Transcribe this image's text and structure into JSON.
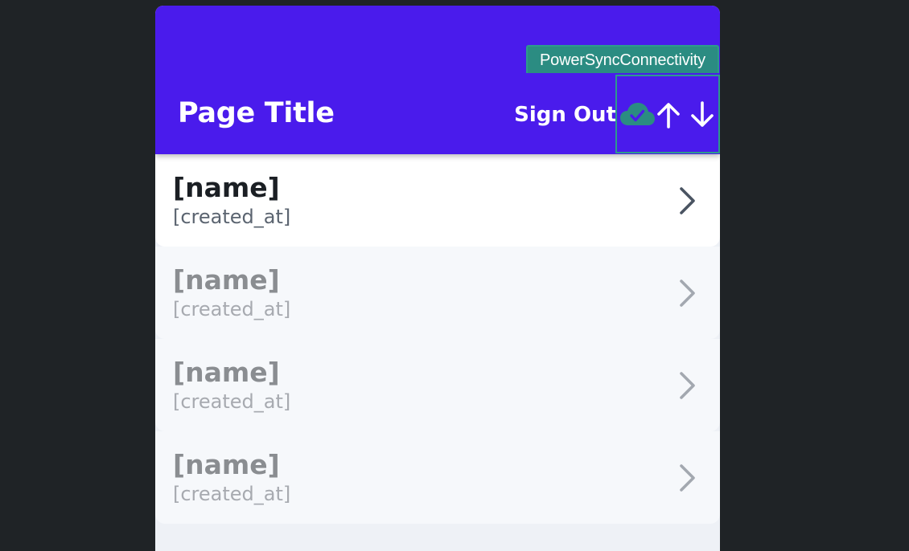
{
  "app_bar": {
    "title": "Page Title",
    "sign_out_label": "Sign Out",
    "background_color": "#4a1bec"
  },
  "connectivity": {
    "tag_label": "PowerSyncConnectivity",
    "tag_color": "#2b8c82",
    "status_icon": "cloud-check-icon",
    "upload_icon": "arrow-up-icon",
    "download_icon": "arrow-down-icon"
  },
  "list": {
    "items": [
      {
        "name": "[name]",
        "created_at": "[created_at]",
        "state": "active"
      },
      {
        "name": "[name]",
        "created_at": "[created_at]",
        "state": "faded"
      },
      {
        "name": "[name]",
        "created_at": "[created_at]",
        "state": "faded"
      },
      {
        "name": "[name]",
        "created_at": "[created_at]",
        "state": "faded"
      }
    ],
    "item_icon": "chevron-right-icon"
  }
}
